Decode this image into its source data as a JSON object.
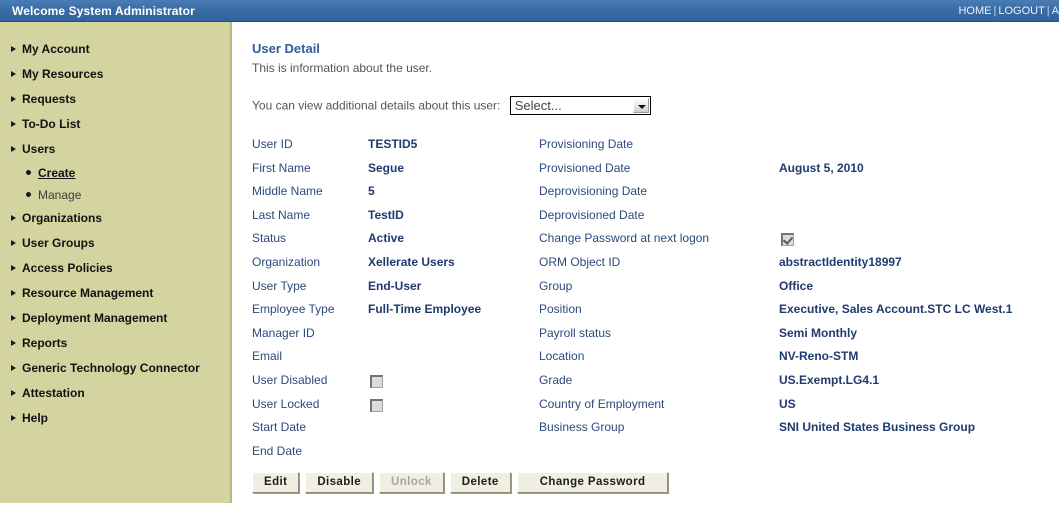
{
  "header": {
    "welcome": "Welcome System Administrator",
    "links": [
      {
        "label": "HOME"
      },
      {
        "label": "LOGOUT"
      },
      {
        "label": "A"
      }
    ],
    "separator": "|"
  },
  "sidebar": {
    "items": [
      {
        "label": "My Account"
      },
      {
        "label": "My Resources"
      },
      {
        "label": "Requests"
      },
      {
        "label": "To-Do List"
      },
      {
        "label": "Users"
      },
      {
        "label": "Organizations"
      },
      {
        "label": "User Groups"
      },
      {
        "label": "Access Policies"
      },
      {
        "label": "Resource Management"
      },
      {
        "label": "Deployment Management"
      },
      {
        "label": "Reports"
      },
      {
        "label": "Generic Technology Connector"
      },
      {
        "label": "Attestation"
      },
      {
        "label": "Help"
      }
    ],
    "users_subitems": [
      {
        "label": "Create",
        "current": true
      },
      {
        "label": "Manage",
        "current": false
      }
    ]
  },
  "main": {
    "title": "User Detail",
    "subtitle": "This is information about the user.",
    "additional_details_label": "You can view additional details about this user:",
    "select": {
      "value": "Select...",
      "options": [
        "Select..."
      ]
    },
    "left_fields": [
      {
        "label": "User ID",
        "value": "TESTID5",
        "type": "text"
      },
      {
        "label": "First Name",
        "value": "Segue",
        "type": "text"
      },
      {
        "label": "Middle Name",
        "value": "5",
        "type": "text"
      },
      {
        "label": "Last Name",
        "value": "TestID",
        "type": "text"
      },
      {
        "label": "Status",
        "value": "Active",
        "type": "text"
      },
      {
        "label": "Organization",
        "value": "Xellerate Users",
        "type": "text"
      },
      {
        "label": "User Type",
        "value": "End-User",
        "type": "text"
      },
      {
        "label": "Employee Type",
        "value": "Full-Time Employee",
        "type": "text"
      },
      {
        "label": "Manager ID",
        "value": "",
        "type": "text"
      },
      {
        "label": "Email",
        "value": "",
        "type": "text"
      },
      {
        "label": "User Disabled",
        "value": "",
        "type": "checkbox",
        "checked": false
      },
      {
        "label": "User Locked",
        "value": "",
        "type": "checkbox",
        "checked": false
      },
      {
        "label": "Start Date",
        "value": "",
        "type": "text"
      },
      {
        "label": "End Date",
        "value": "",
        "type": "text"
      }
    ],
    "right_fields": [
      {
        "label": "Provisioning Date",
        "value": "",
        "type": "text"
      },
      {
        "label": "Provisioned Date",
        "value": "August 5, 2010",
        "type": "text"
      },
      {
        "label": "Deprovisioning Date",
        "value": "",
        "type": "text"
      },
      {
        "label": "Deprovisioned Date",
        "value": "",
        "type": "text"
      },
      {
        "label": "Change Password at next logon",
        "value": "",
        "type": "checkbox",
        "checked": true
      },
      {
        "label": "ORM Object ID",
        "value": "abstractIdentity18997",
        "type": "text"
      },
      {
        "label": "Group",
        "value": "Office",
        "type": "text"
      },
      {
        "label": "Position",
        "value": "Executive, Sales Account.STC LC West.1",
        "type": "text"
      },
      {
        "label": "Payroll status",
        "value": "Semi Monthly",
        "type": "text"
      },
      {
        "label": "Location",
        "value": "NV-Reno-STM",
        "type": "text"
      },
      {
        "label": "Grade",
        "value": "US.Exempt.LG4.1",
        "type": "text"
      },
      {
        "label": "Country of Employment",
        "value": "US",
        "type": "text"
      },
      {
        "label": "Business Group",
        "value": "SNI United States Business Group",
        "type": "text"
      }
    ],
    "buttons": [
      {
        "label": "Edit",
        "disabled": false,
        "wide": false
      },
      {
        "label": "Disable",
        "disabled": false,
        "wide": false
      },
      {
        "label": "Unlock",
        "disabled": true,
        "wide": false
      },
      {
        "label": "Delete",
        "disabled": false,
        "wide": false
      },
      {
        "label": "Change Password",
        "disabled": false,
        "wide": true
      }
    ]
  },
  "colors": {
    "header_blue": "#3a6ca6",
    "sidebar_khaki": "#d4d4a0",
    "title_blue": "#2f5d99",
    "label_blue": "#2b4a7d",
    "value_blue": "#1f3b6e",
    "button_face": "#f0efe2"
  }
}
